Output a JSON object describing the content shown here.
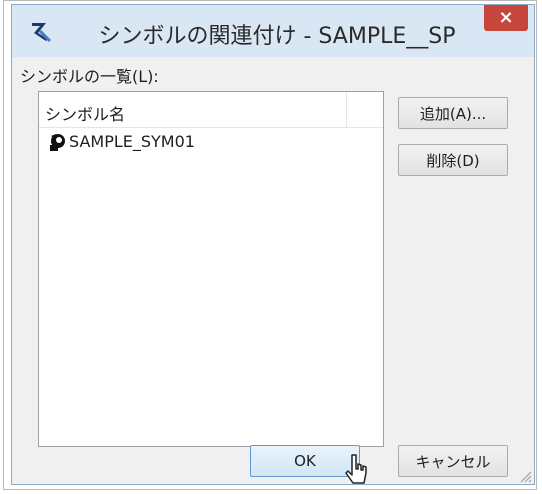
{
  "dialog": {
    "title": "シンボルの関連付け - SAMPLE__SP",
    "close_symbol": "×"
  },
  "list": {
    "caption": "シンボルの一覧(L):",
    "column_header": "シンボル名",
    "items": [
      {
        "label": "SAMPLE_SYM01",
        "icon": "symbol-icon"
      }
    ]
  },
  "buttons": {
    "add": "追加(A)...",
    "delete": "削除(D)",
    "ok": "OK",
    "cancel": "キャンセル"
  },
  "colors": {
    "title_bar": "#d9e6f3",
    "close_button": "#c7463c",
    "dialog_bg": "#f0f0f0",
    "ok_border": "#5b9bd5"
  }
}
